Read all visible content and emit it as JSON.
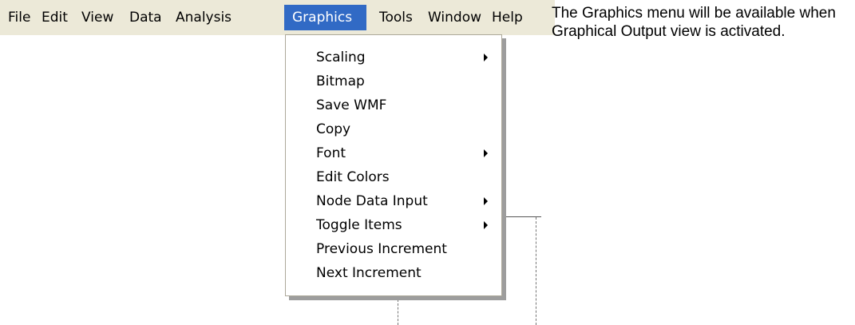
{
  "menubar": {
    "items": [
      {
        "label": "File"
      },
      {
        "label": "Edit"
      },
      {
        "label": "View"
      },
      {
        "label": "Data"
      },
      {
        "label": "Analysis"
      },
      {
        "label": "Graphics"
      },
      {
        "label": "Tools"
      },
      {
        "label": "Window"
      },
      {
        "label": "Help"
      }
    ],
    "active_item": "Graphics",
    "colors": {
      "bar_background": "#ece9d8",
      "highlight": "#316ac5",
      "highlight_text": "#ffffff"
    }
  },
  "graphics_menu": {
    "items": [
      {
        "label": "Scaling",
        "has_submenu": true
      },
      {
        "label": "Bitmap",
        "has_submenu": false
      },
      {
        "label": "Save WMF",
        "has_submenu": false
      },
      {
        "label": "Copy",
        "has_submenu": false
      },
      {
        "label": "Font",
        "has_submenu": true
      },
      {
        "label": "Edit Colors",
        "has_submenu": false
      },
      {
        "label": "Node Data Input",
        "has_submenu": true
      },
      {
        "label": "Toggle Items",
        "has_submenu": true
      },
      {
        "label": "Previous Increment",
        "has_submenu": false
      },
      {
        "label": "Next Increment",
        "has_submenu": false
      }
    ],
    "submenu_icon": "submenu-arrow-icon"
  },
  "help_note": {
    "text": "The Graphics menu will be available when Graphical Output view is activated."
  }
}
